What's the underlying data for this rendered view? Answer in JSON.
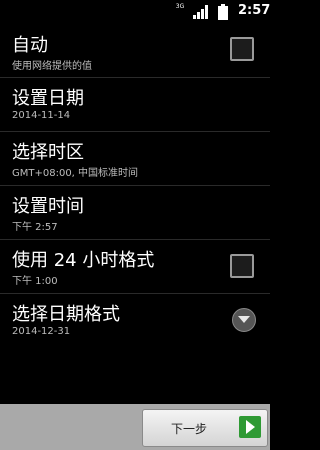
{
  "statusbar": {
    "network": "3G",
    "time": "2:57"
  },
  "settings": [
    {
      "title": "自动",
      "sub": "使用网络提供的值",
      "control": "checkbox"
    },
    {
      "title": "设置日期",
      "sub": "2014-11-14"
    },
    {
      "title": "选择时区",
      "sub": "GMT+08:00, 中国标准时间"
    },
    {
      "title": "设置时间",
      "sub": "下午 2:57"
    },
    {
      "title": "使用 24 小时格式",
      "sub": "下午 1:00",
      "control": "checkbox"
    },
    {
      "title": "选择日期格式",
      "sub": "2014-12-31",
      "control": "dropdown"
    }
  ],
  "footer": {
    "next_label": "下一步"
  },
  "icons": {
    "signal": "signal-icon",
    "battery": "battery-icon",
    "next": "arrow-right-icon",
    "dropdown": "chevron-down-icon"
  },
  "colors": {
    "background": "#000000",
    "bottom_bar": "#a9a9a9",
    "next_icon": "#2f9a34"
  }
}
